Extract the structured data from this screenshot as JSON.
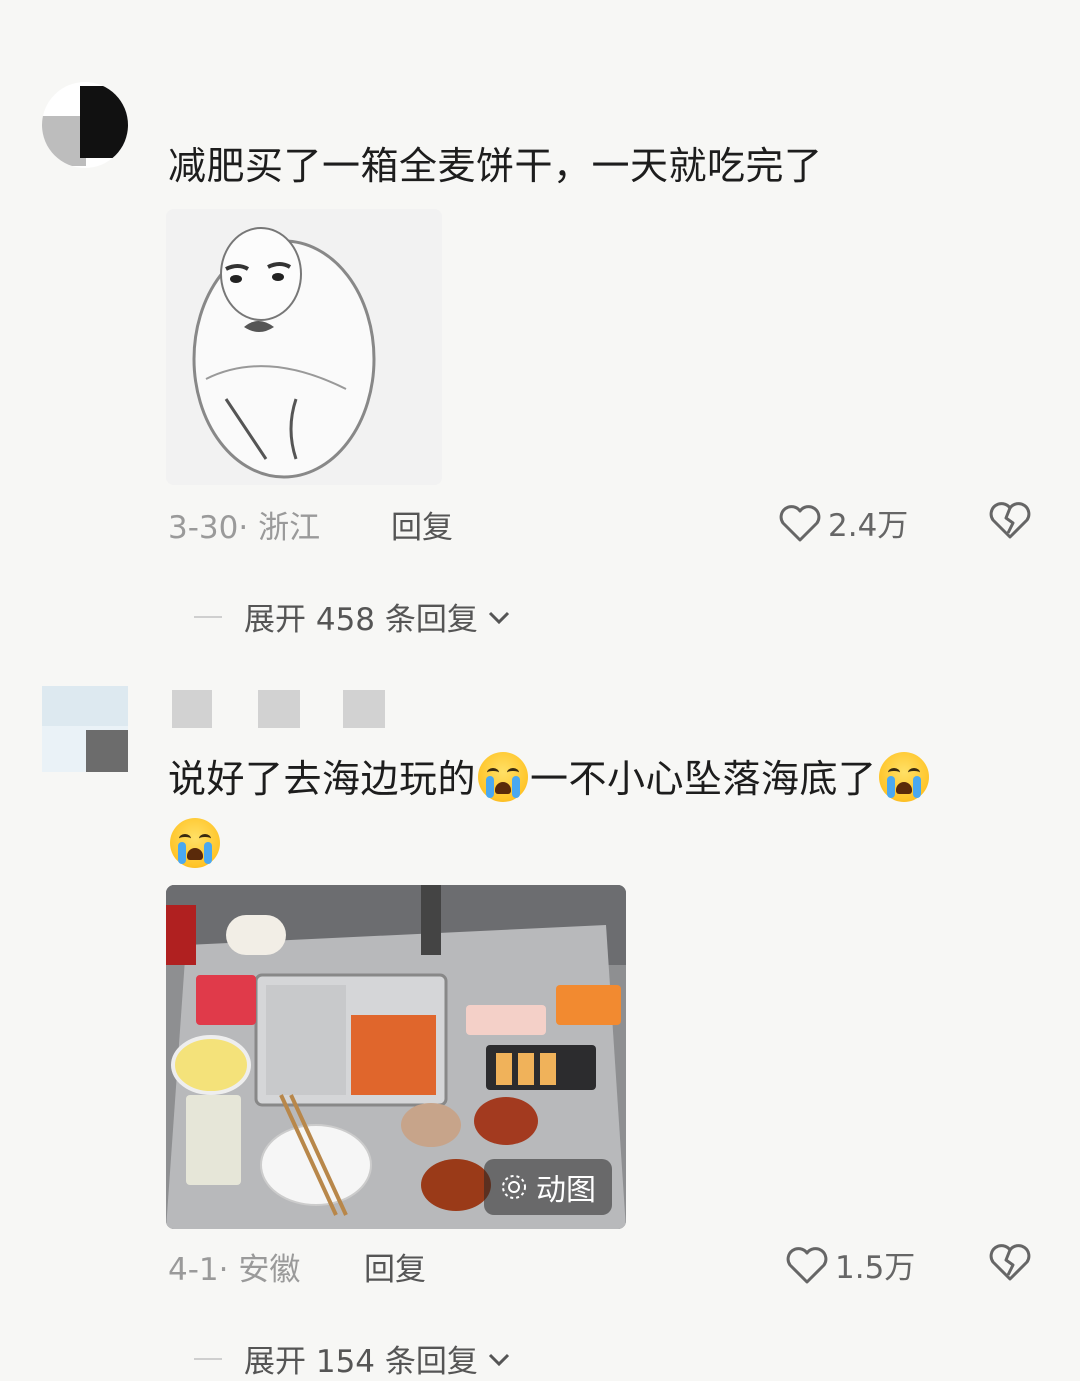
{
  "comments": [
    {
      "text": "减肥买了一箱全麦饼干，一天就吃完了",
      "date_location": "3-30· 浙江",
      "reply_label": "回复",
      "like_count": "2.4万",
      "expand_label": "展开 458 条回复"
    },
    {
      "text_part1": "说好了去海边玩的",
      "text_part2": "一不小心坠落海底了",
      "emoji_name": "loudly-crying-face",
      "image_badge": "动图",
      "date_location": "4-1· 安徽",
      "reply_label": "回复",
      "like_count": "1.5万",
      "expand_label": "展开 154 条回复"
    }
  ],
  "colors": {
    "background": "#f7f7f5",
    "meta_text": "#9a9a9a",
    "body_text": "#1d1d1d"
  }
}
